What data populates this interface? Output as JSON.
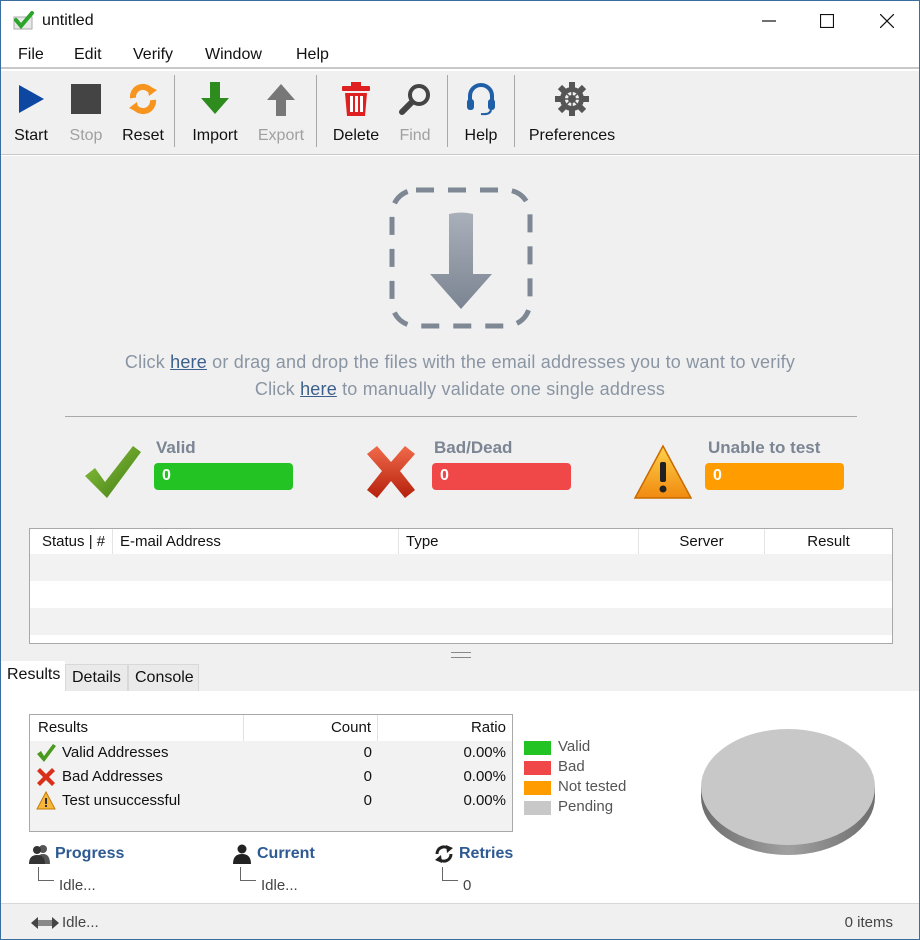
{
  "window": {
    "title": "untitled",
    "controls": {
      "minimize": "minimize",
      "maximize": "maximize",
      "close": "close"
    }
  },
  "menu": [
    "File",
    "Edit",
    "Verify",
    "Window",
    "Help"
  ],
  "toolbar": {
    "start": {
      "label": "Start",
      "icon": "play-icon",
      "enabled": true
    },
    "stop": {
      "label": "Stop",
      "icon": "stop-icon",
      "enabled": false
    },
    "reset": {
      "label": "Reset",
      "icon": "refresh-icon",
      "enabled": true
    },
    "import": {
      "label": "Import",
      "icon": "arrow-down-icon",
      "enabled": true
    },
    "export": {
      "label": "Export",
      "icon": "arrow-up-icon",
      "enabled": false
    },
    "delete": {
      "label": "Delete",
      "icon": "trash-icon",
      "enabled": true
    },
    "find": {
      "label": "Find",
      "icon": "magnifier-icon",
      "enabled": false
    },
    "help": {
      "label": "Help",
      "icon": "headset-icon",
      "enabled": true
    },
    "preferences": {
      "label": "Preferences",
      "icon": "gear-icon",
      "enabled": true
    }
  },
  "dropzone": {
    "line1_prefix": "Click ",
    "line1_link": "here",
    "line1_suffix": " or drag and drop the files with the email addresses you to want to verify",
    "line2_prefix": "Click ",
    "line2_link": "here",
    "line2_suffix": " to manually validate one single address"
  },
  "stats": {
    "valid": {
      "title": "Valid",
      "value": "0",
      "color": "#22c322"
    },
    "bad": {
      "title": "Bad/Dead",
      "value": "0",
      "color": "#f04848"
    },
    "unable": {
      "title": "Unable to test",
      "value": "0",
      "color": "#ff9c00"
    }
  },
  "grid": {
    "columns": [
      "Status | #",
      "E-mail Address",
      "Type",
      "Server",
      "Result"
    ],
    "rows": []
  },
  "tabs": [
    "Results",
    "Details",
    "Console"
  ],
  "active_tab": "Results",
  "results_table": {
    "columns": [
      "Results",
      "Count",
      "Ratio"
    ],
    "rows": [
      {
        "label": "Valid Addresses",
        "count": "0",
        "ratio": "0.00%",
        "icon": "check-icon"
      },
      {
        "label": "Bad Addresses",
        "count": "0",
        "ratio": "0.00%",
        "icon": "x-icon"
      },
      {
        "label": "Test unsuccessful",
        "count": "0",
        "ratio": "0.00%",
        "icon": "warning-icon"
      }
    ]
  },
  "legend": [
    {
      "label": "Valid",
      "color": "#22c322"
    },
    {
      "label": "Bad",
      "color": "#f04848"
    },
    {
      "label": "Not tested",
      "color": "#ff9c00"
    },
    {
      "label": "Pending",
      "color": "#c8c8c8"
    }
  ],
  "chart_data": {
    "type": "pie",
    "title": "",
    "categories": [
      "Valid",
      "Bad",
      "Not tested",
      "Pending"
    ],
    "values": [
      0,
      0,
      0,
      100
    ],
    "colors": [
      "#22c322",
      "#f04848",
      "#ff9c00",
      "#c8c8c8"
    ],
    "legend": "left"
  },
  "info": {
    "progress": {
      "title": "Progress",
      "value": "Idle..."
    },
    "current": {
      "title": "Current",
      "value": "Idle..."
    },
    "retries": {
      "title": "Retries",
      "value": "0"
    }
  },
  "statusbar": {
    "left": "Idle...",
    "right": "0 items"
  }
}
